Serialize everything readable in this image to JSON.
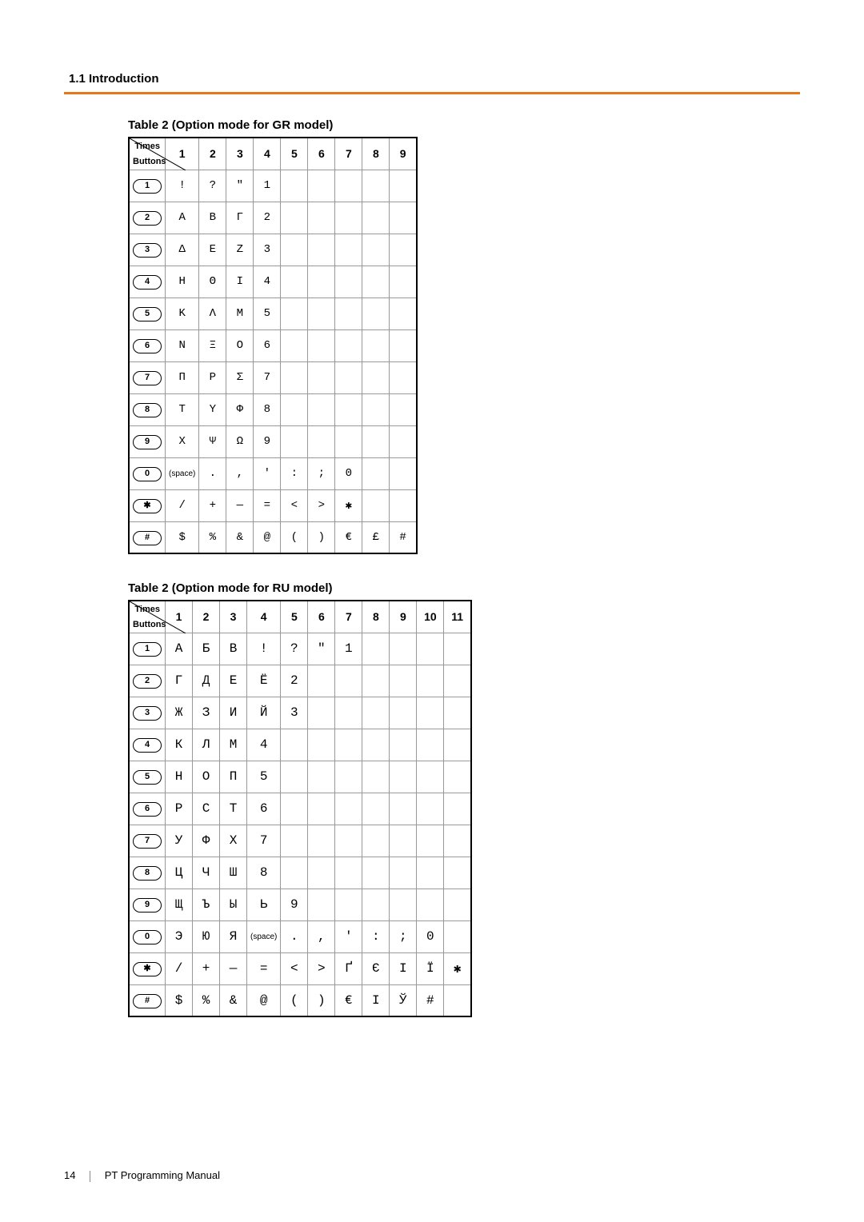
{
  "header": {
    "section": "1.1 Introduction"
  },
  "footer": {
    "page": "14",
    "doc": "PT Programming Manual"
  },
  "corner": {
    "top": "Times",
    "bottom": "Buttons"
  },
  "gr": {
    "caption": "Table 2 (Option mode for GR model)",
    "cols": [
      "1",
      "2",
      "3",
      "4",
      "5",
      "6",
      "7",
      "8",
      "9"
    ],
    "rows": [
      {
        "btn": "1",
        "cells": [
          "!",
          "?",
          "\"",
          "1",
          "",
          "",
          "",
          "",
          ""
        ]
      },
      {
        "btn": "2",
        "cells": [
          "Α",
          "Β",
          "Γ",
          "2",
          "",
          "",
          "",
          "",
          ""
        ]
      },
      {
        "btn": "3",
        "cells": [
          "Δ",
          "Ε",
          "Ζ",
          "3",
          "",
          "",
          "",
          "",
          ""
        ]
      },
      {
        "btn": "4",
        "cells": [
          "Η",
          "Θ",
          "Ι",
          "4",
          "",
          "",
          "",
          "",
          ""
        ]
      },
      {
        "btn": "5",
        "cells": [
          "Κ",
          "Λ",
          "Μ",
          "5",
          "",
          "",
          "",
          "",
          ""
        ]
      },
      {
        "btn": "6",
        "cells": [
          "Ν",
          "Ξ",
          "Ο",
          "6",
          "",
          "",
          "",
          "",
          ""
        ]
      },
      {
        "btn": "7",
        "cells": [
          "Π",
          "Ρ",
          "Σ",
          "7",
          "",
          "",
          "",
          "",
          ""
        ]
      },
      {
        "btn": "8",
        "cells": [
          "Τ",
          "Υ",
          "Φ",
          "8",
          "",
          "",
          "",
          "",
          ""
        ]
      },
      {
        "btn": "9",
        "cells": [
          "Χ",
          "Ψ",
          "Ω",
          "9",
          "",
          "",
          "",
          "",
          ""
        ]
      },
      {
        "btn": "0",
        "cells": [
          "(space)",
          ".",
          ",",
          "'",
          ":",
          ";",
          "0",
          "",
          ""
        ]
      },
      {
        "btn": "✱",
        "cells": [
          "/",
          "+",
          "—",
          "=",
          "<",
          ">",
          "✱",
          "",
          ""
        ]
      },
      {
        "btn": "#",
        "cells": [
          "$",
          "%",
          "&",
          "@",
          "(",
          ")",
          "€",
          "£",
          "#"
        ]
      }
    ]
  },
  "ru": {
    "caption": "Table 2 (Option mode for RU model)",
    "cols": [
      "1",
      "2",
      "3",
      "4",
      "5",
      "6",
      "7",
      "8",
      "9",
      "10",
      "11"
    ],
    "rows": [
      {
        "btn": "1",
        "cells": [
          "А",
          "Б",
          "В",
          "!",
          "?",
          "\"",
          "1",
          "",
          "",
          "",
          ""
        ]
      },
      {
        "btn": "2",
        "cells": [
          "Г",
          "Д",
          "Е",
          "Ё",
          "2",
          "",
          "",
          "",
          "",
          "",
          ""
        ]
      },
      {
        "btn": "3",
        "cells": [
          "Ж",
          "З",
          "И",
          "Й",
          "3",
          "",
          "",
          "",
          "",
          "",
          ""
        ]
      },
      {
        "btn": "4",
        "cells": [
          "К",
          "Л",
          "М",
          "4",
          "",
          "",
          "",
          "",
          "",
          "",
          ""
        ]
      },
      {
        "btn": "5",
        "cells": [
          "Н",
          "О",
          "П",
          "5",
          "",
          "",
          "",
          "",
          "",
          "",
          ""
        ]
      },
      {
        "btn": "6",
        "cells": [
          "Р",
          "С",
          "Т",
          "6",
          "",
          "",
          "",
          "",
          "",
          "",
          ""
        ]
      },
      {
        "btn": "7",
        "cells": [
          "У",
          "Ф",
          "Х",
          "7",
          "",
          "",
          "",
          "",
          "",
          "",
          ""
        ]
      },
      {
        "btn": "8",
        "cells": [
          "Ц",
          "Ч",
          "Ш",
          "8",
          "",
          "",
          "",
          "",
          "",
          "",
          ""
        ]
      },
      {
        "btn": "9",
        "cells": [
          "Щ",
          "Ъ",
          "Ы",
          "Ь",
          "9",
          "",
          "",
          "",
          "",
          "",
          ""
        ]
      },
      {
        "btn": "0",
        "cells": [
          "Э",
          "Ю",
          "Я",
          "(space)",
          ".",
          ",",
          "'",
          ":",
          ";",
          "0",
          ""
        ]
      },
      {
        "btn": "✱",
        "cells": [
          "/",
          "+",
          "—",
          "=",
          "<",
          ">",
          "Ґ",
          "Є",
          "І",
          "Ї",
          "✱"
        ]
      },
      {
        "btn": "#",
        "cells": [
          "$",
          "%",
          "&",
          "@",
          "(",
          ")",
          "€",
          "І",
          "Ў",
          "#",
          ""
        ]
      }
    ]
  }
}
